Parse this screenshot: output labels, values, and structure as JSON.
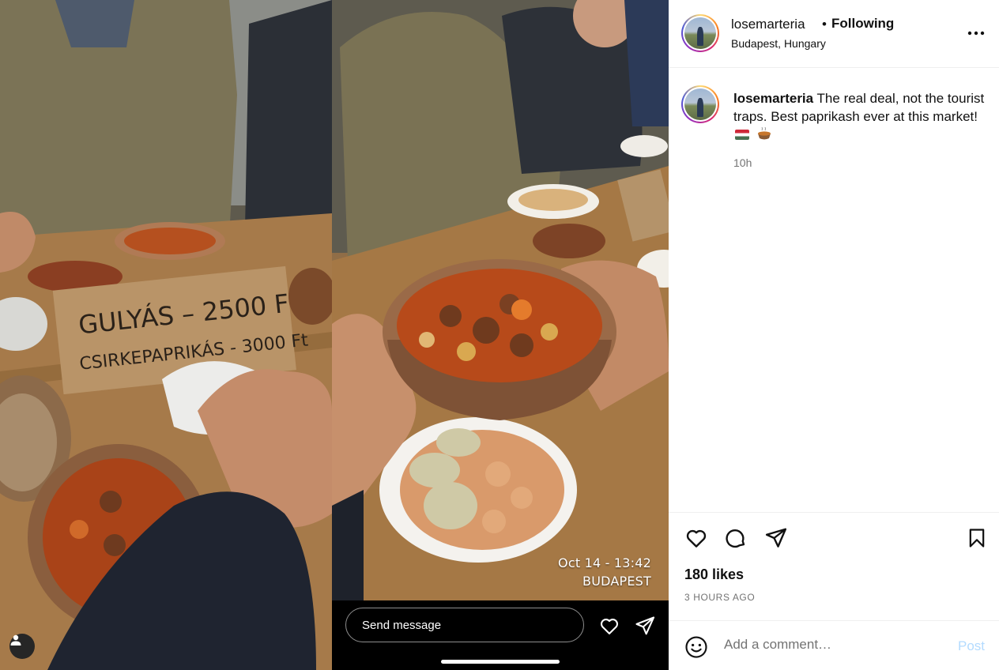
{
  "left_photo": {
    "sign_line1": "GULYÁS – 2500 Ft",
    "sign_line2": "CSIRKEPAPRIKÁS - 3000 Ft",
    "profile_icon": "user-icon"
  },
  "story": {
    "date_stamp": "Oct 14 - 13:42",
    "city_stamp": "BUDAPEST",
    "send_placeholder": "Send message",
    "icons": [
      "heart-icon",
      "send-icon"
    ]
  },
  "post": {
    "header": {
      "username": "losemarteria",
      "separator": "•",
      "follow_status": "Following",
      "location": "Budapest, Hungary",
      "more_icon": "more-horizontal-icon"
    },
    "caption": {
      "username": "losemarteria",
      "text": "The real deal, not the tourist traps. Best paprikash ever at this market!",
      "emoji": [
        "flag-hungary",
        "stew-bowl"
      ],
      "time": "10h"
    },
    "actions": {
      "icons": [
        "heart-icon",
        "comment-icon",
        "share-icon",
        "bookmark-icon"
      ],
      "likes": "180 likes",
      "posted_ago": "3 HOURS AGO"
    },
    "comment": {
      "placeholder": "Add a comment…",
      "post_label": "Post",
      "post_color": "#b3dbff"
    }
  }
}
